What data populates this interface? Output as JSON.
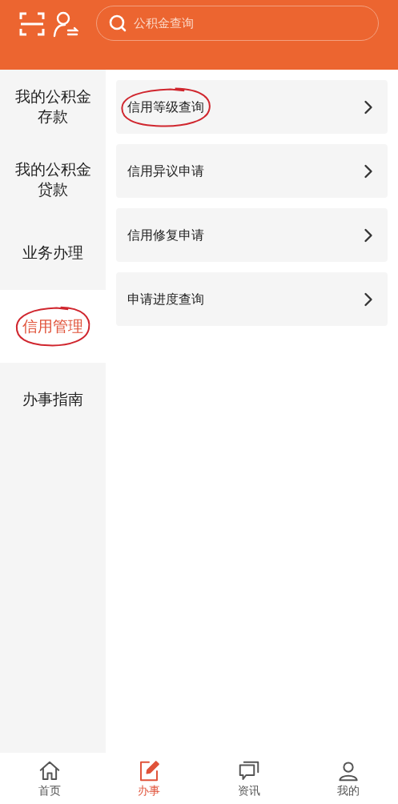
{
  "search": {
    "placeholder": "公积金查询"
  },
  "sidebar": {
    "items": [
      {
        "label": "我的公积金存款",
        "selected": false,
        "circled": false
      },
      {
        "label": "我的公积金贷款",
        "selected": false,
        "circled": false
      },
      {
        "label": "业务办理",
        "selected": false,
        "circled": false
      },
      {
        "label": "信用管理",
        "selected": true,
        "circled": true
      },
      {
        "label": "办事指南",
        "selected": false,
        "circled": false
      }
    ]
  },
  "menu": [
    {
      "label": "信用等级查询",
      "circled": true
    },
    {
      "label": "信用异议申请",
      "circled": false
    },
    {
      "label": "信用修复申请",
      "circled": false
    },
    {
      "label": "申请进度查询",
      "circled": false
    }
  ],
  "tab_bar": [
    {
      "label": "首页",
      "kind": "home",
      "selected": false
    },
    {
      "label": "办事",
      "kind": "edit",
      "selected": true
    },
    {
      "label": "资讯",
      "kind": "chat",
      "selected": false
    },
    {
      "label": "我的",
      "kind": "user",
      "selected": false
    }
  ]
}
